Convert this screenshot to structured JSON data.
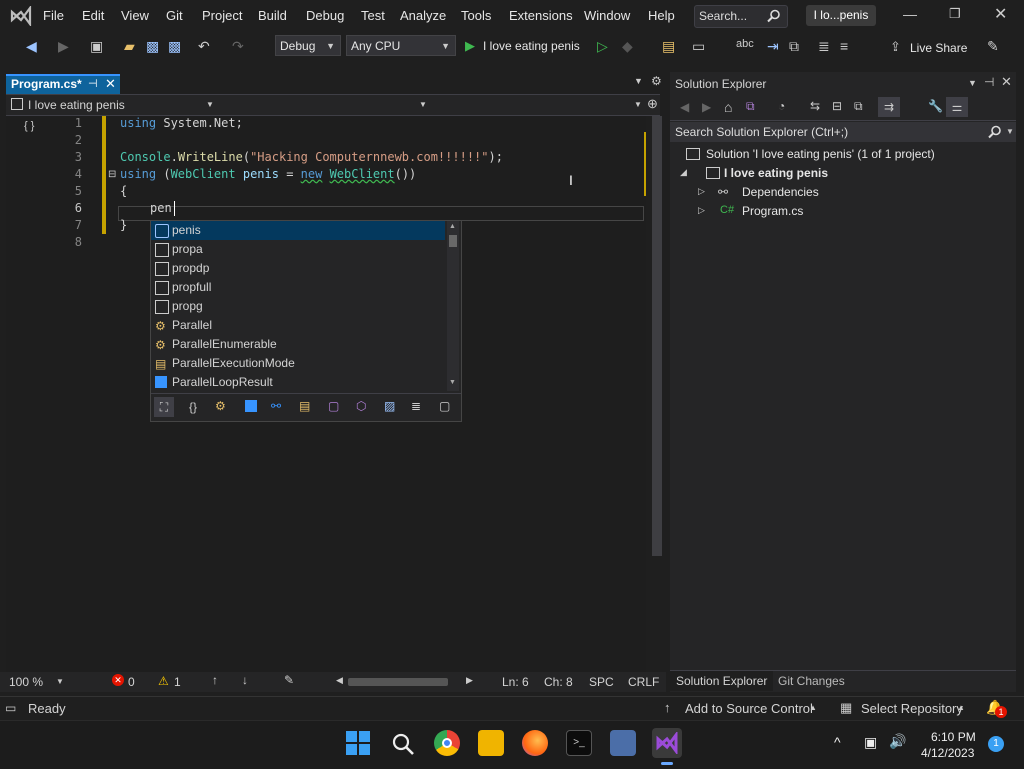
{
  "menubar": {
    "items": [
      "File",
      "Edit",
      "View",
      "Git",
      "Project",
      "Build",
      "Debug",
      "Test",
      "Analyze",
      "Tools",
      "Extensions",
      "Window",
      "Help"
    ],
    "search_label": "Search...",
    "window_title": "I lo...penis"
  },
  "toolbar": {
    "config": "Debug",
    "platform": "Any CPU",
    "run_label": "I love eating penis",
    "live_share": "Live Share"
  },
  "editor": {
    "tab_label": "Program.cs*",
    "nav_project": "I love eating penis",
    "line_numbers": [
      "1",
      "2",
      "3",
      "4",
      "5",
      "6",
      "7",
      "8"
    ],
    "lines": {
      "l1_kw": "using",
      "l1_rest": " System.Net;",
      "l3_cls": "Console",
      "l3_fn": "WriteLine",
      "l3_str": "\"Hacking Computernnewb.com!!!!!!\"",
      "l4_kw": "using",
      "l4_type": "WebClient",
      "l4_var": "penis",
      "l4_new": "new",
      "l4_ctor": "WebClient",
      "l5": "{",
      "l6": "pen",
      "l7": "}"
    }
  },
  "completion": {
    "items": [
      {
        "label": "penis",
        "kind": "local"
      },
      {
        "label": "propa",
        "kind": "snippet"
      },
      {
        "label": "propdp",
        "kind": "snippet"
      },
      {
        "label": "propfull",
        "kind": "snippet"
      },
      {
        "label": "propg",
        "kind": "snippet"
      },
      {
        "label": "Parallel",
        "kind": "class"
      },
      {
        "label": "ParallelEnumerable",
        "kind": "class"
      },
      {
        "label": "ParallelExecutionMode",
        "kind": "enum"
      },
      {
        "label": "ParallelLoopResult",
        "kind": "struct"
      }
    ]
  },
  "solution_explorer": {
    "title": "Solution Explorer",
    "search_placeholder": "Search Solution Explorer (Ctrl+;)",
    "solution": "Solution 'I love eating penis' (1 of 1 project)",
    "project": "I love eating penis",
    "dependencies": "Dependencies",
    "program_file": "Program.cs",
    "tab_se": "Solution Explorer",
    "tab_git": "Git Changes"
  },
  "editor_status": {
    "zoom": "100 %",
    "errors": "0",
    "warnings": "1",
    "line": "Ln: 6",
    "col": "Ch: 8",
    "spc": "SPC",
    "eol": "CRLF"
  },
  "statusbar": {
    "ready": "Ready",
    "add_source": "Add to Source Control",
    "select_repo": "Select Repository",
    "notif_count": "1"
  },
  "taskbar": {
    "time": "6:10 PM",
    "date": "4/12/2023",
    "badge": "1"
  },
  "colors": {
    "accent": "#0e639c",
    "vs_purple": "#9b4bd8",
    "keyword": "#569cd6",
    "type": "#4ec9b0",
    "string": "#d69d85"
  }
}
